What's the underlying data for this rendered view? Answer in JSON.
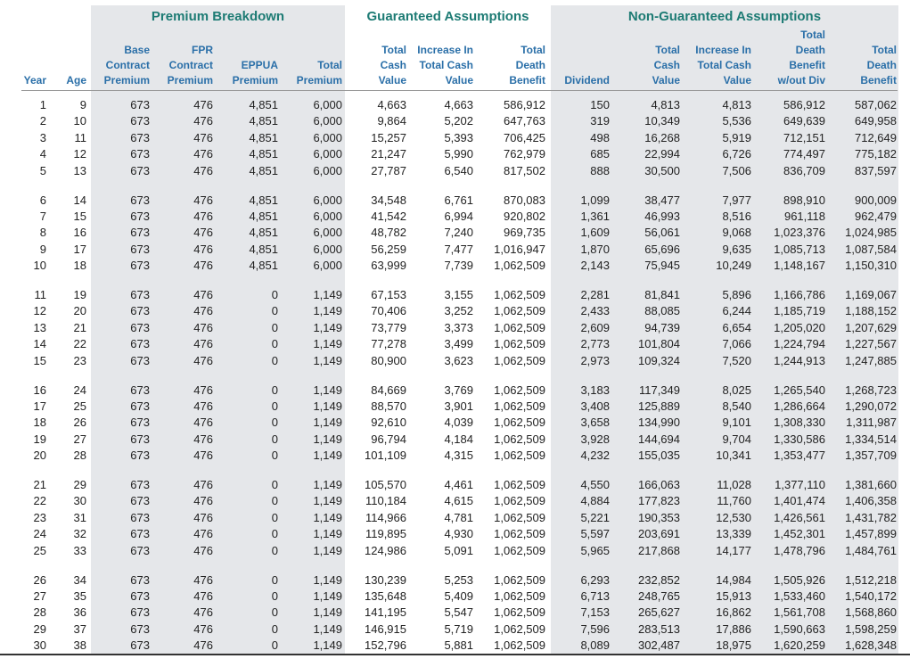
{
  "groups": {
    "premium": "Premium Breakdown",
    "guaranteed": "Guaranteed Assumptions",
    "non_guaranteed": "Non-Guaranteed Assumptions"
  },
  "columns": [
    {
      "key": "year",
      "label": [
        "Year"
      ]
    },
    {
      "key": "age",
      "label": [
        "Age"
      ]
    },
    {
      "key": "base",
      "label": [
        "Base",
        "Contract",
        "Premium"
      ]
    },
    {
      "key": "fpr",
      "label": [
        "FPR",
        "Contract",
        "Premium"
      ]
    },
    {
      "key": "eppua",
      "label": [
        "EPPUA",
        "Premium"
      ]
    },
    {
      "key": "total_premium",
      "label": [
        "Total",
        "Premium"
      ]
    },
    {
      "key": "g_tcv",
      "label": [
        "Total",
        "Cash",
        "Value"
      ]
    },
    {
      "key": "g_inc",
      "label": [
        "Increase In",
        "Total Cash",
        "Value"
      ]
    },
    {
      "key": "g_tdb",
      "label": [
        "Total",
        "Death",
        "Benefit"
      ]
    },
    {
      "key": "dividend",
      "label": [
        "Dividend"
      ]
    },
    {
      "key": "ng_tcv",
      "label": [
        "Total",
        "Cash",
        "Value"
      ]
    },
    {
      "key": "ng_inc",
      "label": [
        "Increase In",
        "Total Cash",
        "Value"
      ]
    },
    {
      "key": "ng_tdb_wo",
      "label": [
        "Total",
        "Death",
        "Benefit",
        "w/out Div"
      ]
    },
    {
      "key": "ng_tdb",
      "label": [
        "Total",
        "Death",
        "Benefit"
      ]
    }
  ],
  "rows": [
    [
      "1",
      "9",
      "673",
      "476",
      "4,851",
      "6,000",
      "4,663",
      "4,663",
      "586,912",
      "150",
      "4,813",
      "4,813",
      "586,912",
      "587,062"
    ],
    [
      "2",
      "10",
      "673",
      "476",
      "4,851",
      "6,000",
      "9,864",
      "5,202",
      "647,763",
      "319",
      "10,349",
      "5,536",
      "649,639",
      "649,958"
    ],
    [
      "3",
      "11",
      "673",
      "476",
      "4,851",
      "6,000",
      "15,257",
      "5,393",
      "706,425",
      "498",
      "16,268",
      "5,919",
      "712,151",
      "712,649"
    ],
    [
      "4",
      "12",
      "673",
      "476",
      "4,851",
      "6,000",
      "21,247",
      "5,990",
      "762,979",
      "685",
      "22,994",
      "6,726",
      "774,497",
      "775,182"
    ],
    [
      "5",
      "13",
      "673",
      "476",
      "4,851",
      "6,000",
      "27,787",
      "6,540",
      "817,502",
      "888",
      "30,500",
      "7,506",
      "836,709",
      "837,597"
    ],
    [
      "6",
      "14",
      "673",
      "476",
      "4,851",
      "6,000",
      "34,548",
      "6,761",
      "870,083",
      "1,099",
      "38,477",
      "7,977",
      "898,910",
      "900,009"
    ],
    [
      "7",
      "15",
      "673",
      "476",
      "4,851",
      "6,000",
      "41,542",
      "6,994",
      "920,802",
      "1,361",
      "46,993",
      "8,516",
      "961,118",
      "962,479"
    ],
    [
      "8",
      "16",
      "673",
      "476",
      "4,851",
      "6,000",
      "48,782",
      "7,240",
      "969,735",
      "1,609",
      "56,061",
      "9,068",
      "1,023,376",
      "1,024,985"
    ],
    [
      "9",
      "17",
      "673",
      "476",
      "4,851",
      "6,000",
      "56,259",
      "7,477",
      "1,016,947",
      "1,870",
      "65,696",
      "9,635",
      "1,085,713",
      "1,087,584"
    ],
    [
      "10",
      "18",
      "673",
      "476",
      "4,851",
      "6,000",
      "63,999",
      "7,739",
      "1,062,509",
      "2,143",
      "75,945",
      "10,249",
      "1,148,167",
      "1,150,310"
    ],
    [
      "11",
      "19",
      "673",
      "476",
      "0",
      "1,149",
      "67,153",
      "3,155",
      "1,062,509",
      "2,281",
      "81,841",
      "5,896",
      "1,166,786",
      "1,169,067"
    ],
    [
      "12",
      "20",
      "673",
      "476",
      "0",
      "1,149",
      "70,406",
      "3,252",
      "1,062,509",
      "2,433",
      "88,085",
      "6,244",
      "1,185,719",
      "1,188,152"
    ],
    [
      "13",
      "21",
      "673",
      "476",
      "0",
      "1,149",
      "73,779",
      "3,373",
      "1,062,509",
      "2,609",
      "94,739",
      "6,654",
      "1,205,020",
      "1,207,629"
    ],
    [
      "14",
      "22",
      "673",
      "476",
      "0",
      "1,149",
      "77,278",
      "3,499",
      "1,062,509",
      "2,773",
      "101,804",
      "7,066",
      "1,224,794",
      "1,227,567"
    ],
    [
      "15",
      "23",
      "673",
      "476",
      "0",
      "1,149",
      "80,900",
      "3,623",
      "1,062,509",
      "2,973",
      "109,324",
      "7,520",
      "1,244,913",
      "1,247,885"
    ],
    [
      "16",
      "24",
      "673",
      "476",
      "0",
      "1,149",
      "84,669",
      "3,769",
      "1,062,509",
      "3,183",
      "117,349",
      "8,025",
      "1,265,540",
      "1,268,723"
    ],
    [
      "17",
      "25",
      "673",
      "476",
      "0",
      "1,149",
      "88,570",
      "3,901",
      "1,062,509",
      "3,408",
      "125,889",
      "8,540",
      "1,286,664",
      "1,290,072"
    ],
    [
      "18",
      "26",
      "673",
      "476",
      "0",
      "1,149",
      "92,610",
      "4,039",
      "1,062,509",
      "3,658",
      "134,990",
      "9,101",
      "1,308,330",
      "1,311,987"
    ],
    [
      "19",
      "27",
      "673",
      "476",
      "0",
      "1,149",
      "96,794",
      "4,184",
      "1,062,509",
      "3,928",
      "144,694",
      "9,704",
      "1,330,586",
      "1,334,514"
    ],
    [
      "20",
      "28",
      "673",
      "476",
      "0",
      "1,149",
      "101,109",
      "4,315",
      "1,062,509",
      "4,232",
      "155,035",
      "10,341",
      "1,353,477",
      "1,357,709"
    ],
    [
      "21",
      "29",
      "673",
      "476",
      "0",
      "1,149",
      "105,570",
      "4,461",
      "1,062,509",
      "4,550",
      "166,063",
      "11,028",
      "1,377,110",
      "1,381,660"
    ],
    [
      "22",
      "30",
      "673",
      "476",
      "0",
      "1,149",
      "110,184",
      "4,615",
      "1,062,509",
      "4,884",
      "177,823",
      "11,760",
      "1,401,474",
      "1,406,358"
    ],
    [
      "23",
      "31",
      "673",
      "476",
      "0",
      "1,149",
      "114,966",
      "4,781",
      "1,062,509",
      "5,221",
      "190,353",
      "12,530",
      "1,426,561",
      "1,431,782"
    ],
    [
      "24",
      "32",
      "673",
      "476",
      "0",
      "1,149",
      "119,895",
      "4,930",
      "1,062,509",
      "5,597",
      "203,691",
      "13,339",
      "1,452,301",
      "1,457,899"
    ],
    [
      "25",
      "33",
      "673",
      "476",
      "0",
      "1,149",
      "124,986",
      "5,091",
      "1,062,509",
      "5,965",
      "217,868",
      "14,177",
      "1,478,796",
      "1,484,761"
    ],
    [
      "26",
      "34",
      "673",
      "476",
      "0",
      "1,149",
      "130,239",
      "5,253",
      "1,062,509",
      "6,293",
      "232,852",
      "14,984",
      "1,505,926",
      "1,512,218"
    ],
    [
      "27",
      "35",
      "673",
      "476",
      "0",
      "1,149",
      "135,648",
      "5,409",
      "1,062,509",
      "6,713",
      "248,765",
      "15,913",
      "1,533,460",
      "1,540,172"
    ],
    [
      "28",
      "36",
      "673",
      "476",
      "0",
      "1,149",
      "141,195",
      "5,547",
      "1,062,509",
      "7,153",
      "265,627",
      "16,862",
      "1,561,708",
      "1,568,860"
    ],
    [
      "29",
      "37",
      "673",
      "476",
      "0",
      "1,149",
      "146,915",
      "5,719",
      "1,062,509",
      "7,596",
      "283,513",
      "17,886",
      "1,590,663",
      "1,598,259"
    ],
    [
      "30",
      "38",
      "673",
      "476",
      "0",
      "1,149",
      "152,796",
      "5,881",
      "1,062,509",
      "8,089",
      "302,487",
      "18,975",
      "1,620,259",
      "1,628,348"
    ]
  ]
}
